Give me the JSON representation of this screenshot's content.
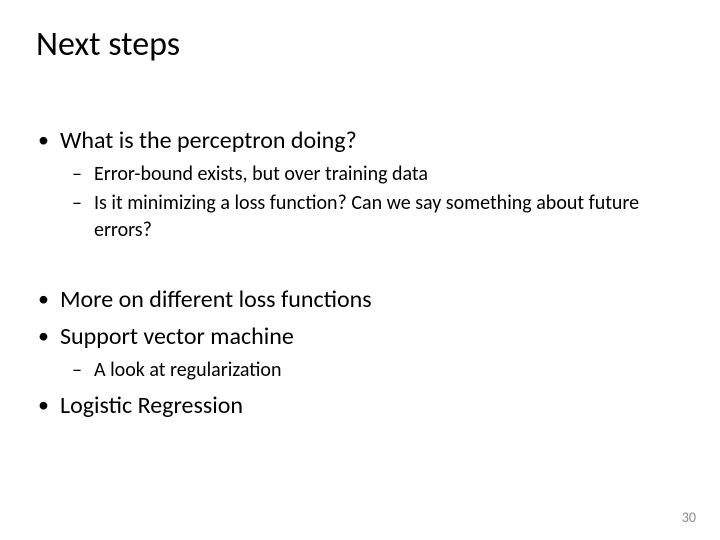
{
  "title": "Next steps",
  "bullets": {
    "b1": "What is the perceptron doing?",
    "b1_sub1": "Error-bound exists, but over training data",
    "b1_sub2": "Is it minimizing a loss function? Can we say something about future errors?",
    "b2": "More on different loss functions",
    "b3": "Support vector machine",
    "b3_sub1": "A look at regularization",
    "b4": "Logistic Regression"
  },
  "page_number": "30"
}
